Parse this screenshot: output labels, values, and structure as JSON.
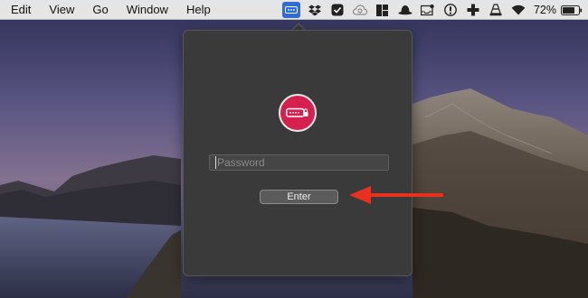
{
  "menubar": {
    "items": [
      "Edit",
      "View",
      "Go",
      "Window",
      "Help"
    ],
    "status_icons": [
      "password-app-icon",
      "dropbox-icon",
      "checkmark-icon",
      "creative-cloud-icon",
      "layout-icon",
      "bowler-hat-icon",
      "notification-icon",
      "info-icon",
      "plus-icon",
      "vlc-cone-icon",
      "wifi-icon"
    ],
    "battery_percent": "72%"
  },
  "popover": {
    "password_placeholder": "Password",
    "enter_label": "Enter"
  },
  "colors": {
    "accent_red": "#d6204f",
    "arrow_red": "#e8301f",
    "menubar_highlight": "#2f6bd9"
  }
}
